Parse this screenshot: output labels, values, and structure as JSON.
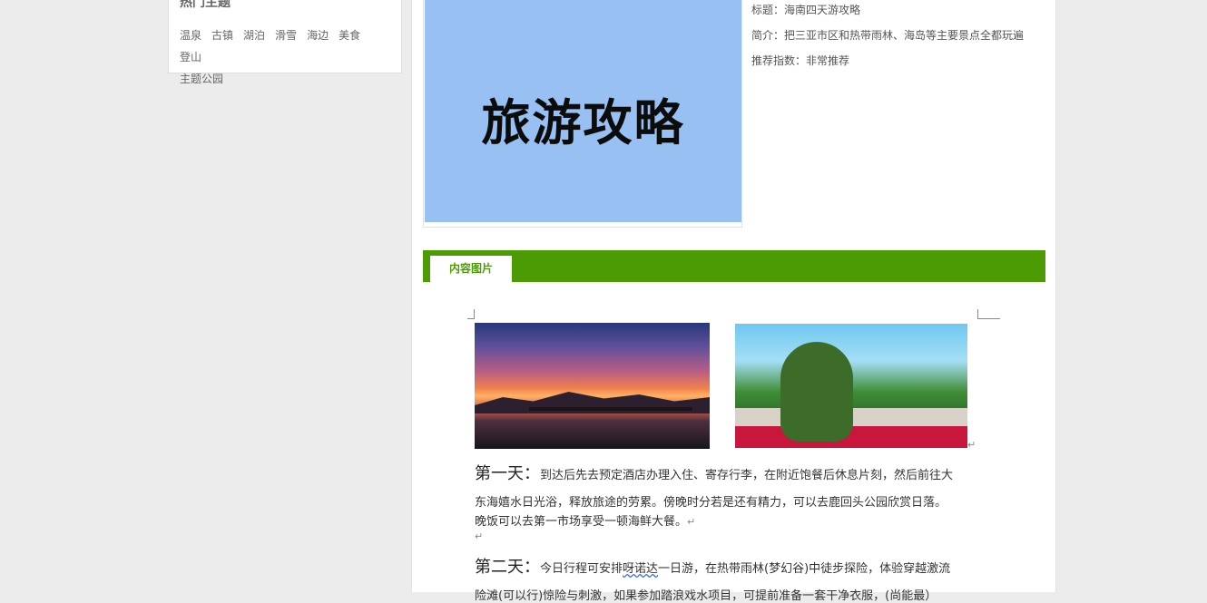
{
  "sidebar": {
    "title": "热门主题",
    "tags": [
      "温泉",
      "古镇",
      "湖泊",
      "滑雪",
      "海边",
      "美食",
      "登山",
      "主题公园"
    ]
  },
  "cover": {
    "text": "旅游攻略",
    "bg_color": "#99c0f3"
  },
  "meta": {
    "title": "标题：海南四天游攻略",
    "intro": "简介：把三亚市区和热带雨林、海岛等主要景点全都玩遍",
    "rating": "推荐指数：非常推荐"
  },
  "tab": {
    "label": "内容图片",
    "accent_color": "#4d9b04"
  },
  "images": [
    {
      "name": "sunset-pier-photo"
    },
    {
      "name": "topiary-hand-garden-photo"
    }
  ],
  "marks": {
    "paragraph": "↵"
  },
  "content": {
    "day1": {
      "label": "第一天：",
      "line1": "到达后先去预定酒店办理入住、寄存行李，在附近饱餐后休息片刻，然后前往大",
      "line2": "东海嬉水日光浴，释放旅途的劳累。傍晚时分若是还有精力，可以去鹿回头公园欣赏日落。",
      "line3": "晚饭可以去第一市场享受一顿海鲜大餐。"
    },
    "day2": {
      "label": "第二天：",
      "line1_pre": "今日行程可安排",
      "line1_underlined": "呀诺达",
      "line1_post": "一日游，在热带雨林(梦幻谷)中徒步探险，体验穿越激流",
      "line2": "险滩(可以行)惊险与刺激，如果参加踏浪戏水项目，可提前准备一套干净衣服，(尚能最）"
    }
  }
}
